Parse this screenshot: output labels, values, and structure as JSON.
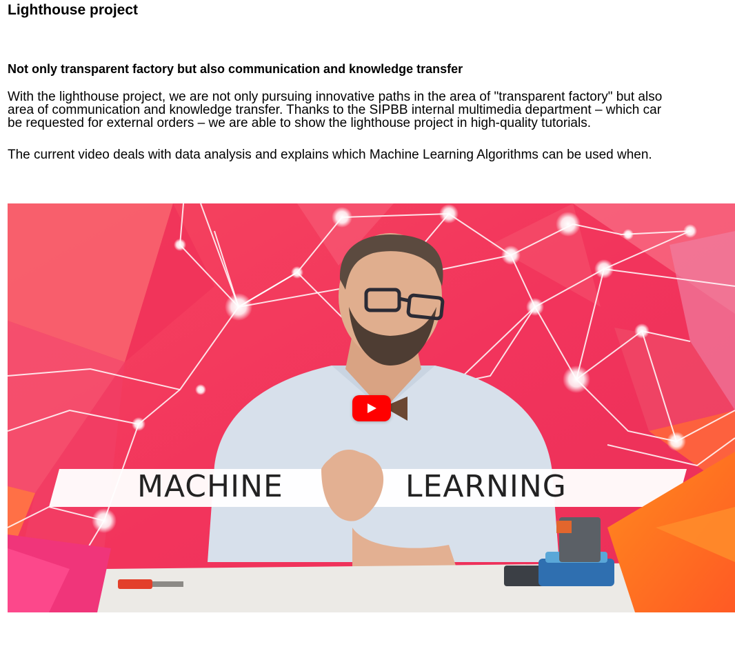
{
  "page": {
    "title": "Lighthouse project"
  },
  "section": {
    "heading": "Not only transparent factory but also communication and knowledge transfer",
    "paragraph_1_lines": [
      "With the lighthouse project, we are not only pursuing innovative paths in the area of \"transparent factory\" but also",
      "area of communication and knowledge transfer. Thanks to the SIPBB internal multimedia department – which car",
      "be requested for external orders – we are able to show the lighthouse project in high-quality tutorials."
    ],
    "paragraph_2": "The current video deals with data analysis and explains which Machine Learning Algorithms can be used when."
  },
  "video": {
    "thumbnail_word_left": "MACHINE",
    "thumbnail_word_right": "LEARNING",
    "play_icon": "youtube-play-icon",
    "colors": {
      "background": "#f23a5d",
      "banner": "#ffffff",
      "banner_text": "#222222",
      "play_button": "#ff0000",
      "accent_orange": "#ff6a21"
    }
  }
}
